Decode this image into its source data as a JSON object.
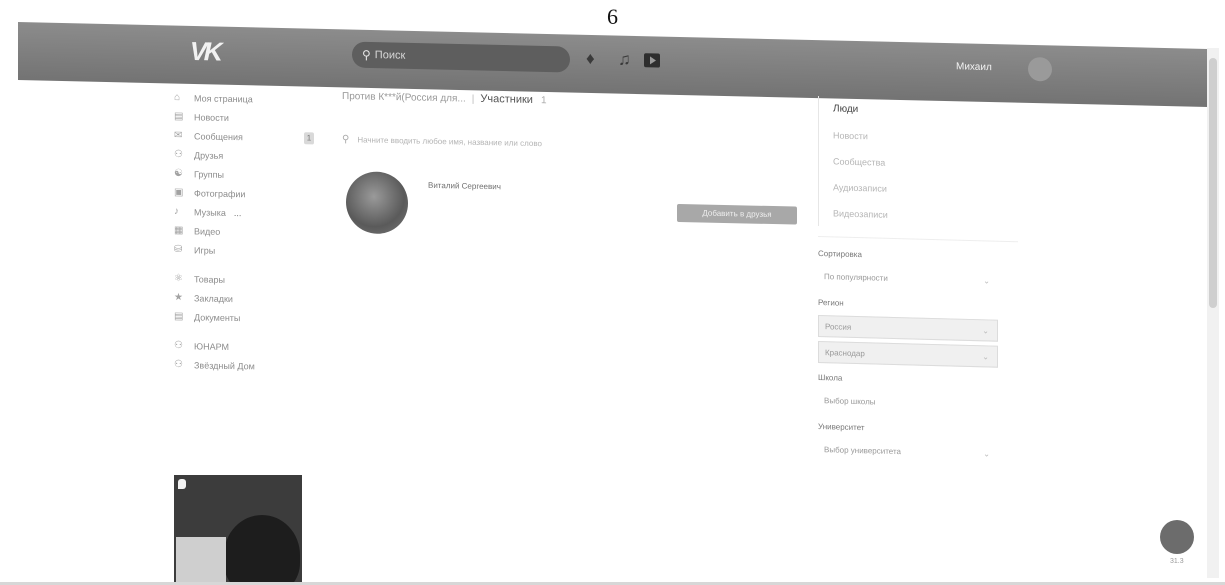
{
  "page_number": "6",
  "topbar": {
    "logo": "VK",
    "search_placeholder": "Поиск",
    "icons": [
      "bell-icon",
      "music-icon",
      "video-icon"
    ],
    "user_name": "Михаил"
  },
  "sidebar": {
    "items": [
      {
        "icon": "home-icon",
        "label": "Моя страница"
      },
      {
        "icon": "news-icon",
        "label": "Новости"
      },
      {
        "icon": "messages-icon",
        "label": "Сообщения",
        "badge": "1"
      },
      {
        "icon": "friends-icon",
        "label": "Друзья"
      },
      {
        "icon": "groups-icon",
        "label": "Группы"
      },
      {
        "icon": "photo-icon",
        "label": "Фотографии"
      },
      {
        "icon": "music-icon",
        "label": "Музыка",
        "extra": "..."
      },
      {
        "icon": "video-icon",
        "label": "Видео"
      },
      {
        "icon": "games-icon",
        "label": "Игры"
      },
      {
        "icon": "market-icon",
        "label": "Товары"
      },
      {
        "icon": "bookmark-icon",
        "label": "Закладки"
      },
      {
        "icon": "docs-icon",
        "label": "Документы"
      },
      {
        "icon": "group-icon",
        "label": "ЮНАРМ"
      },
      {
        "icon": "group-icon",
        "label": "Звёздный Дом"
      }
    ]
  },
  "main": {
    "breadcrumb_group": "Против К***й(Россия для...",
    "breadcrumb_current": "Участники",
    "breadcrumb_count": "1",
    "search_placeholder": "Начните вводить любое имя, название или слово",
    "member": {
      "name": "Виталий Сергеевич",
      "button_label": "Добавить в друзья"
    }
  },
  "right_panel": {
    "nav": [
      "Люди",
      "Новости",
      "Сообщества",
      "Аудиозаписи",
      "Видеозаписи"
    ],
    "active": "Люди",
    "sort_label": "Сортировка",
    "sort_value": "По популярности",
    "region_label": "Регион",
    "country_value": "Россия",
    "city_value": "Краснодар",
    "school_label": "Школа",
    "school_value": "Выбор школы",
    "university_label": "Университет",
    "university_value": "Выбор университета"
  },
  "chat_caption": "31.3"
}
